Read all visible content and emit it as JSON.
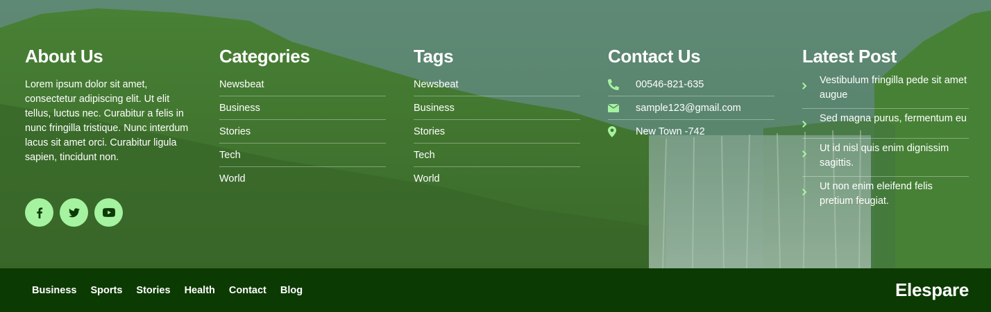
{
  "about": {
    "heading": "About Us",
    "text": "Lorem ipsum dolor sit amet, consectetur adipiscing elit. Ut elit tellus, luctus nec. Curabitur a felis in nunc fringilla tristique. Nunc interdum lacus sit amet orci. Curabitur ligula sapien, tincidunt non.",
    "social": [
      {
        "icon": "facebook-icon"
      },
      {
        "icon": "twitter-icon"
      },
      {
        "icon": "youtube-icon"
      }
    ]
  },
  "categories": {
    "heading": "Categories",
    "items": [
      "Newsbeat",
      "Business",
      "Stories",
      "Tech",
      "World"
    ]
  },
  "tags": {
    "heading": "Tags",
    "items": [
      "Newsbeat",
      "Business",
      "Stories",
      "Tech",
      "World"
    ]
  },
  "contact": {
    "heading": "Contact Us",
    "items": [
      {
        "icon": "phone-icon",
        "text": "00546-821-635"
      },
      {
        "icon": "envelope-icon",
        "text": "sample123@gmail.com"
      },
      {
        "icon": "map-marker-icon",
        "text": "New Town -742"
      }
    ]
  },
  "latest": {
    "heading": "Latest Post",
    "posts": [
      "Vestibulum fringilla pede sit amet augue",
      "Sed magna purus, fermentum eu",
      "Ut id nisl quis enim dignissim sagittis.",
      "Ut non enim eleifend felis pretium feugiat."
    ]
  },
  "bottom": {
    "nav": [
      "Business",
      "Sports",
      "Stories",
      "Health",
      "Contact",
      "Blog"
    ],
    "brand": "Elespare"
  },
  "colors": {
    "accent": "#a5f3a0",
    "bottom_bar": "#0c3a03",
    "icon_dark": "#0c3a03"
  }
}
